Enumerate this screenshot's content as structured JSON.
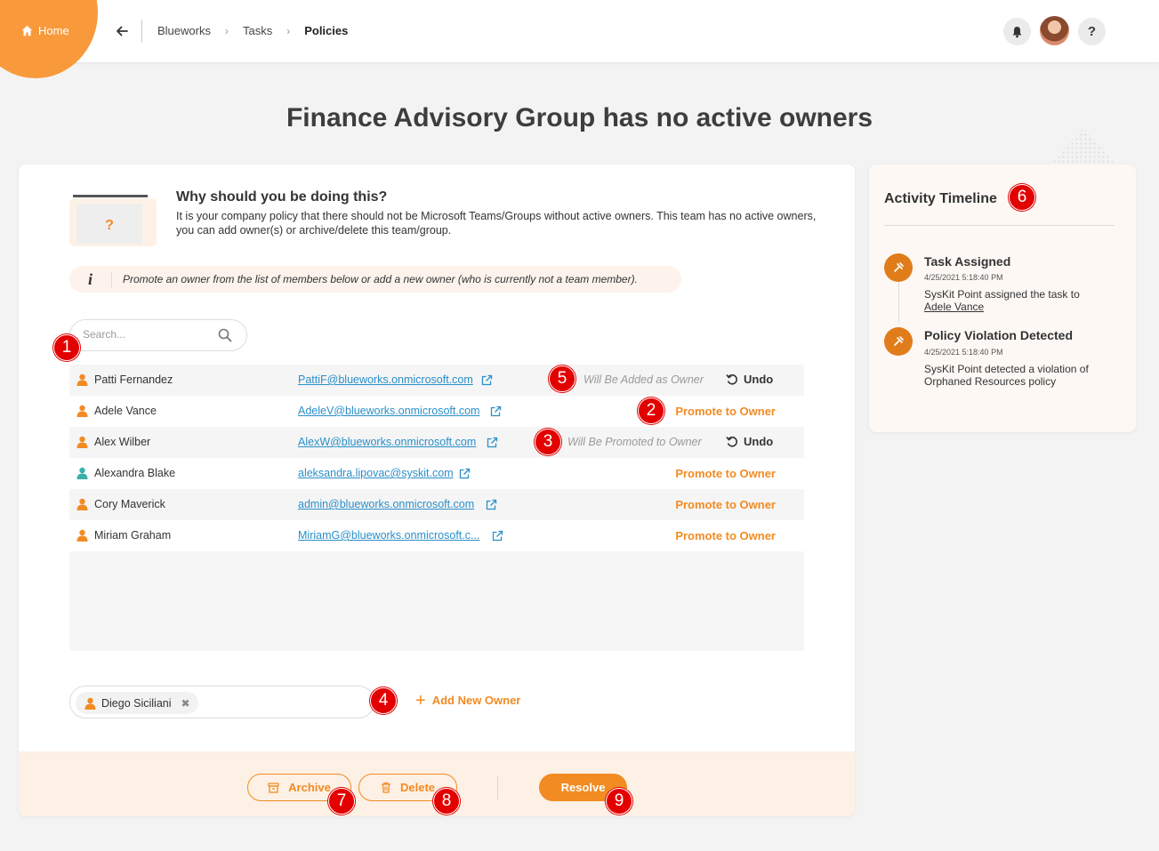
{
  "header": {
    "home_label": "Home",
    "breadcrumbs": [
      "Blueworks",
      "Tasks",
      "Policies"
    ]
  },
  "page": {
    "title": "Finance Advisory Group has no active owners"
  },
  "why": {
    "title": "Why should you be doing this?",
    "text": "It is your company policy that there should not be Microsoft Teams/Groups without active owners. This team has no active owners, you can add owner(s) or archive/delete this team/group."
  },
  "info": {
    "icon_text": "i",
    "text": "Promote an owner from the list of members below or add a new owner (who is currently not a team member)."
  },
  "search": {
    "placeholder": "Search...",
    "value": ""
  },
  "members": [
    {
      "name": "Patti Fernandez",
      "email": "PattiF@blueworks.onmicrosoft.com",
      "status": "Will Be Added as Owner",
      "action": "Undo",
      "icon_color": "#f28b22"
    },
    {
      "name": "Adele Vance",
      "email": "AdeleV@blueworks.onmicrosoft.com",
      "status": "",
      "action": "Promote to Owner",
      "icon_color": "#f28b22"
    },
    {
      "name": "Alex Wilber",
      "email": "AlexW@blueworks.onmicrosoft.com",
      "status": "Will Be Promoted to Owner",
      "action": "Undo",
      "icon_color": "#f28b22"
    },
    {
      "name": "Alexandra Blake",
      "email": "aleksandra.lipovac@syskit.com",
      "status": "",
      "action": "Promote to Owner",
      "icon_color": "#3ab0a8"
    },
    {
      "name": "Cory Maverick",
      "email": "admin@blueworks.onmicrosoft.com",
      "status": "",
      "action": "Promote to Owner",
      "icon_color": "#f28b22"
    },
    {
      "name": "Miriam Graham",
      "email": "MiriamG@blueworks.onmicrosoft.c...",
      "status": "",
      "action": "Promote to Owner",
      "icon_color": "#f28b22"
    }
  ],
  "new_owner": {
    "chip_name": "Diego Siciliani",
    "add_label": "Add New Owner"
  },
  "footer": {
    "archive_label": "Archive",
    "delete_label": "Delete",
    "resolve_label": "Resolve"
  },
  "timeline": {
    "title": "Activity Timeline",
    "events": [
      {
        "title": "Task Assigned",
        "time": "4/25/2021 5:18:40 PM",
        "desc": "SysKit Point assigned the task to",
        "link": "Adele Vance"
      },
      {
        "title": "Policy Violation Detected",
        "time": "4/25/2021 5:18:40 PM",
        "desc": "SysKit Point detected a violation of Orphaned Resources policy",
        "link": ""
      }
    ]
  },
  "markers": [
    "1",
    "2",
    "3",
    "4",
    "5",
    "6",
    "7",
    "8",
    "9"
  ],
  "colors": {
    "accent": "#f28b22",
    "marker": "#e30000",
    "link": "#2a8fc9"
  }
}
